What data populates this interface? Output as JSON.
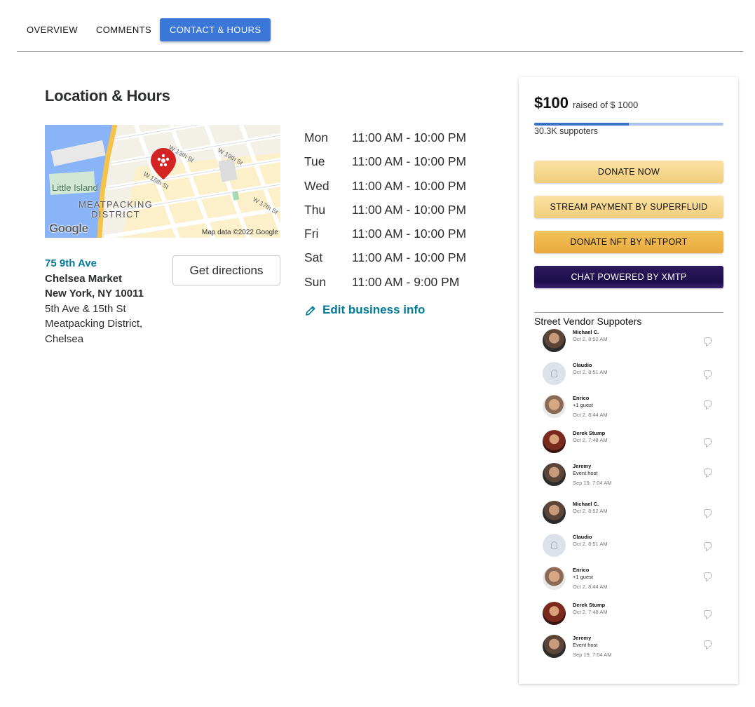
{
  "tabs": [
    {
      "label": "OVERVIEW",
      "active": false
    },
    {
      "label": "COMMENTS",
      "active": false
    },
    {
      "label": "CONTACT & HOURS",
      "active": true
    }
  ],
  "location": {
    "title": "Location & Hours",
    "map": {
      "labels": [
        "Little Island",
        "MEATPACKING",
        "DISTRICT",
        "W 19th St",
        "W 15th St",
        "W 17th St",
        "W 13th St"
      ],
      "brand": "Google",
      "attribution": "Map data ©2022 Google"
    },
    "address": {
      "street": "75 9th Ave",
      "line2": "Chelsea Market",
      "line3": "New York, NY 10011",
      "line4": "5th Ave & 15th St",
      "line5": "Meatpacking District,",
      "line6": "Chelsea"
    },
    "directions_label": "Get directions",
    "hours": [
      {
        "day": "Mon",
        "time": "11:00 AM - 10:00 PM"
      },
      {
        "day": "Tue",
        "time": "11:00 AM - 10:00 PM"
      },
      {
        "day": "Wed",
        "time": "11:00 AM - 10:00 PM"
      },
      {
        "day": "Thu",
        "time": "11:00 AM - 10:00 PM"
      },
      {
        "day": "Fri",
        "time": "11:00 AM - 10:00 PM"
      },
      {
        "day": "Sat",
        "time": "11:00 AM - 10:00 PM"
      },
      {
        "day": "Sun",
        "time": "11:00 AM - 9:00 PM"
      }
    ],
    "edit_label": "Edit business info"
  },
  "fundraiser": {
    "amount": "$100",
    "goal_text": "raised of $ 1000",
    "progress_fraction": 0.5,
    "supporters_text": "30.3K suppoters",
    "buttons": {
      "donate": "DONATE NOW",
      "stream": "STREAM PAYMENT BY SUPERFLUID",
      "nft": "DONATE NFT BY NFTPORT",
      "chat": "CHAT POWERED BY XMTP"
    },
    "supporters_title": "Street Vendor Suppoters",
    "supporters": [
      {
        "name": "Michael C.",
        "sub": "",
        "time": "Oct 2, 8:52 AM",
        "avatar": "photo"
      },
      {
        "name": "Claudio",
        "sub": "",
        "time": "Oct 2, 8:51 AM",
        "avatar": "placeholder"
      },
      {
        "name": "Enrico",
        "sub": "+1 guest",
        "time": "Oct 2, 8:44 AM",
        "avatar": "bald"
      },
      {
        "name": "Derek Stump",
        "sub": "",
        "time": "Oct 2, 7:48 AM",
        "avatar": "red"
      },
      {
        "name": "Jeremy",
        "sub": "Event host",
        "time": "Sep 19, 7:04 AM",
        "avatar": "photo"
      },
      {
        "name": "Michael C.",
        "sub": "",
        "time": "Oct 2, 8:52 AM",
        "avatar": "photo"
      },
      {
        "name": "Claudio",
        "sub": "",
        "time": "Oct 2, 8:51 AM",
        "avatar": "placeholder"
      },
      {
        "name": "Enrico",
        "sub": "+1 guest",
        "time": "Oct 2, 8:44 AM",
        "avatar": "bald"
      },
      {
        "name": "Derek Stump",
        "sub": "",
        "time": "Oct 2, 7:48 AM",
        "avatar": "red"
      },
      {
        "name": "Jeremy",
        "sub": "Event host",
        "time": "Sep 19, 7:04 AM",
        "avatar": "photo"
      }
    ]
  },
  "colors": {
    "tab_active": "#3b77d9",
    "link": "#027a97",
    "progress_fill": "#3b6fcc",
    "progress_track": "#a9c0ec",
    "donate_gold": "#f1cd7a",
    "nft_orange": "#e9a93c",
    "chat_purple": "#1c0e4a",
    "map_pin": "#d32323"
  },
  "icons": {
    "map_pin": "yelp-map-pin-icon",
    "edit": "pencil-icon",
    "supporter_action": "chat-bubble-icon"
  }
}
